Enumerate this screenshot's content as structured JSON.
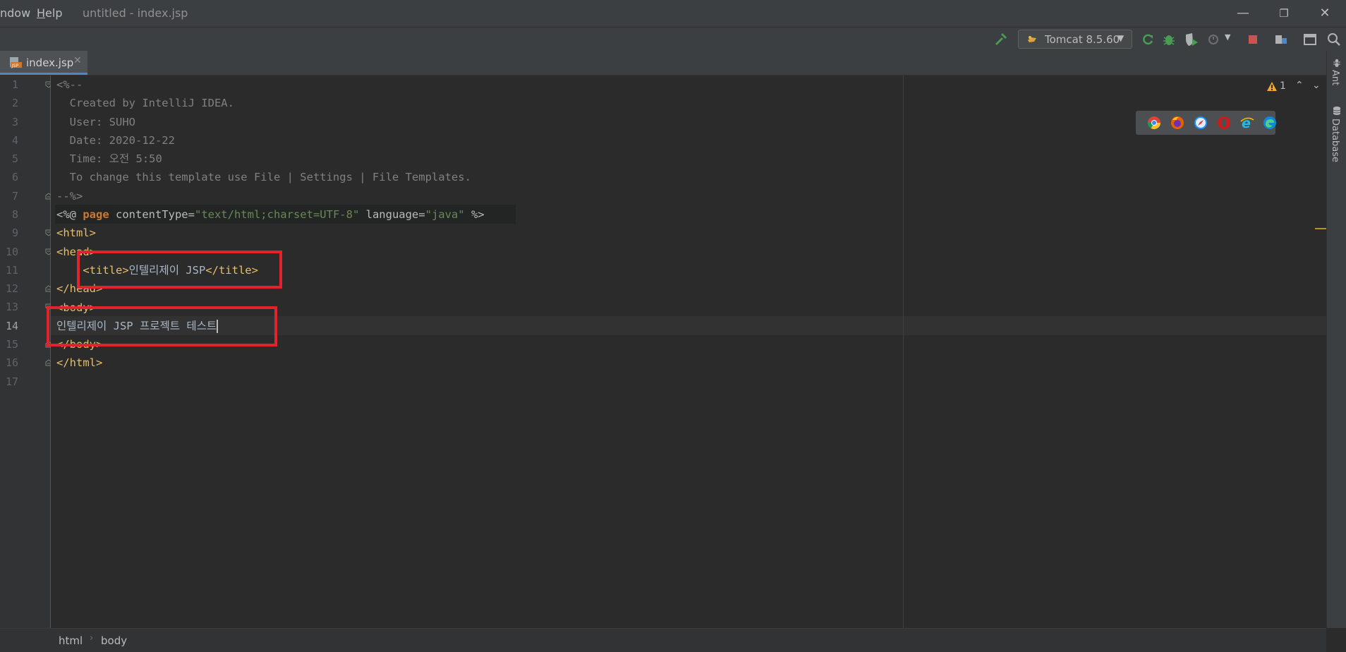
{
  "menu": {
    "window": "ndow",
    "help_first": "H",
    "help_rest": "elp"
  },
  "window_title": "untitled - index.jsp",
  "window_controls": {
    "minimize": "—",
    "restore": "❐",
    "close": "✕"
  },
  "toolbar": {
    "build_icon": "hammer-icon",
    "run_config": {
      "label": "Tomcat 8.5.60",
      "icon": "tomcat-icon"
    },
    "actions": [
      "rerun-icon",
      "debug-icon",
      "coverage-icon",
      "profile-icon",
      "stop-icon",
      "project-structure-icon",
      "layout-icon",
      "search-icon"
    ]
  },
  "tabs": [
    {
      "label": "index.jsp",
      "icon": "jsp-file-icon",
      "close": "✕"
    }
  ],
  "editor": {
    "current_line": 14,
    "line_numbers": [
      "1",
      "2",
      "3",
      "4",
      "5",
      "6",
      "7",
      "8",
      "9",
      "10",
      "11",
      "12",
      "13",
      "14",
      "15",
      "16",
      "17"
    ],
    "lines": {
      "l1": "<%--",
      "l2": "  Created by IntelliJ IDEA.",
      "l3": "  User: SUHO",
      "l4": "  Date: 2020-12-22",
      "l5": "  Time: 오전 5:50",
      "l6": "  To change this template use File | Settings | File Templates.",
      "l7": "--%>",
      "l8": {
        "open": "<%@ ",
        "kw": "page",
        "attr1": " contentType=",
        "val1": "\"text/html;charset=UTF-8\"",
        "attr2": " language=",
        "val2": "\"java\"",
        "close": " %>"
      },
      "l9": "<html>",
      "l10": "<head>",
      "l11": {
        "indent": "    ",
        "open": "<title>",
        "text": "인텔리제이 JSP",
        "close": "</title>"
      },
      "l12": "</head>",
      "l13": "<body>",
      "l14": "인텔리제이 JSP 프로젝트 테스트",
      "l15": "</body>",
      "l16": "</html>",
      "l17": ""
    }
  },
  "inspection": {
    "warnings": "1",
    "up": "⌃",
    "down": "⌄"
  },
  "browsers": [
    "chrome-icon",
    "firefox-icon",
    "safari-icon",
    "opera-icon",
    "ie-icon",
    "edge-icon"
  ],
  "right_stripe": {
    "ant": "Ant",
    "database": "Database"
  },
  "breadcrumb": [
    "html",
    "body"
  ],
  "colors": {
    "tag": "#e8bf6a",
    "comment": "#808080",
    "keyword": "#cc7832",
    "string": "#6a8759",
    "highlight": "#e0232c"
  }
}
